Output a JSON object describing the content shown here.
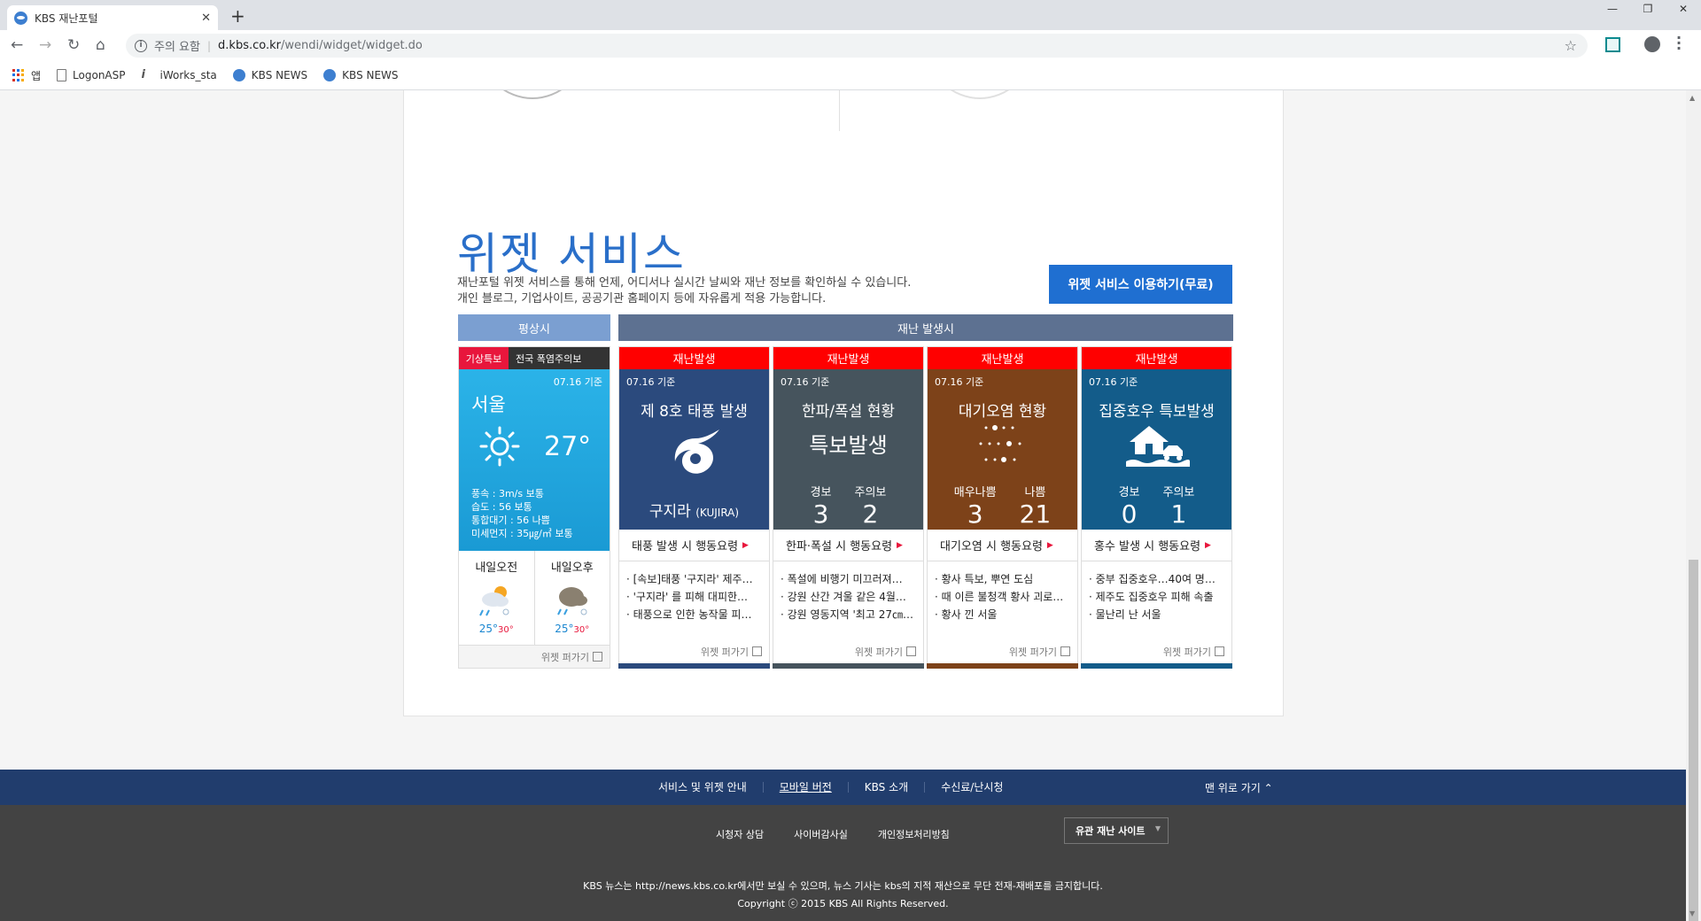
{
  "browser": {
    "tab_title": "KBS 재난포털",
    "new_tab": "+",
    "security_label": "주의 요함",
    "url_host": "d.kbs.co.kr",
    "url_path": "/wendi/widget/widget.do",
    "bookmarks": [
      "앱",
      "LogonASP",
      "iWorks_sta",
      "KBS NEWS",
      "KBS NEWS"
    ]
  },
  "section": {
    "title": "위젯 서비스",
    "desc_line1": "재난포털 위젯 서비스를 통해 언제, 어디서나 실시간 날씨와 재난 정보를 확인하실 수 있습니다.",
    "desc_line2": "개인 블로그, 기업사이트, 공공기관 홈페이지 등에 자유롭게 적용 가능합니다.",
    "cta": "위젯 서비스 이용하기(무료)",
    "header_normal": "평상시",
    "header_disaster": "재난 발생시"
  },
  "normal_widget": {
    "tag": "기상특보",
    "alert": "전국 폭염주의보",
    "date": "07.16 기준",
    "city": "서울",
    "temp": "27°",
    "wind": "풍속 : 3m/s 보통",
    "humidity": "습도 : 56 보통",
    "air": "통합대기 : 56 나쁨",
    "dust": "미세먼지 : 35㎍/㎥ 보통",
    "am_label": "내일오전",
    "pm_label": "내일오후",
    "am_lo": "25°",
    "am_hi": "30°",
    "pm_lo": "25°",
    "pm_hi": "30°",
    "share": "위젯 퍼가기"
  },
  "disaster_widgets": [
    {
      "tag": "재난발생",
      "date": "07.16 기준",
      "title": "제 8호 태풍 발생",
      "name": "구지라",
      "name_en": "(KUJIRA)",
      "link": "태풍 발생 시 행동요령",
      "news": [
        "· [속보]태풍 '구지라' 제주…",
        "· '구지라' 를 피해 대피한…",
        "· 태풍으로 인한 농작물 피…"
      ],
      "share": "위젯 퍼가기",
      "color": "#2b4a7d"
    },
    {
      "tag": "재난발생",
      "date": "07.16 기준",
      "title": "한파/폭설 현황",
      "sub": "특보발생",
      "c1_label": "경보",
      "c1": "3",
      "c2_label": "주의보",
      "c2": "2",
      "link": "한파·폭설 시 행동요령",
      "news": [
        "· 폭설에 비행기 미끄러져…",
        "· 강원 산간 겨울 같은 4월…",
        "· 강원 영동지역 '최고 27㎝…"
      ],
      "share": "위젯 퍼가기",
      "color": "#46545d"
    },
    {
      "tag": "재난발생",
      "date": "07.16 기준",
      "title": "대기오염 현황",
      "c1_label": "매우나쁨",
      "c1": "3",
      "c2_label": "나쁨",
      "c2": "21",
      "link": "대기오염 시 행동요령",
      "news": [
        "· 황사 특보, 뿌연 도심",
        "· 때 이른 불청객 황사 괴로…",
        "· 황사 낀 서울"
      ],
      "share": "위젯 퍼가기",
      "color": "#7d4219"
    },
    {
      "tag": "재난발생",
      "date": "07.16 기준",
      "title": "집중호우 특보발생",
      "c1_label": "경보",
      "c1": "0",
      "c2_label": "주의보",
      "c2": "1",
      "link": "홍수 발생 시 행동요령",
      "news": [
        "· 중부 집중호우…40여 명…",
        "· 제주도 집중호우 피해 속출",
        "· 물난리 난 서울"
      ],
      "share": "위젯 퍼가기",
      "color": "#135c8a"
    }
  ],
  "footer": {
    "nav": [
      "서비스 및 위젯 안내",
      "모바일 버전",
      "KBS 소개",
      "수신료/난시청"
    ],
    "top": "맨 위로 가기",
    "links": [
      "시청자 상담",
      "사이버감사실",
      "개인정보처리방침"
    ],
    "select": "유관 재난 사이트",
    "notice": "KBS 뉴스는 http://news.kbs.co.kr에서만 보실 수 있으며, 뉴스 기사는 kbs의 지적 재산으로 무단 전재-재배포를 금지합니다.",
    "copyright": "Copyright ⓒ 2015 KBS All Rights Reserved."
  }
}
